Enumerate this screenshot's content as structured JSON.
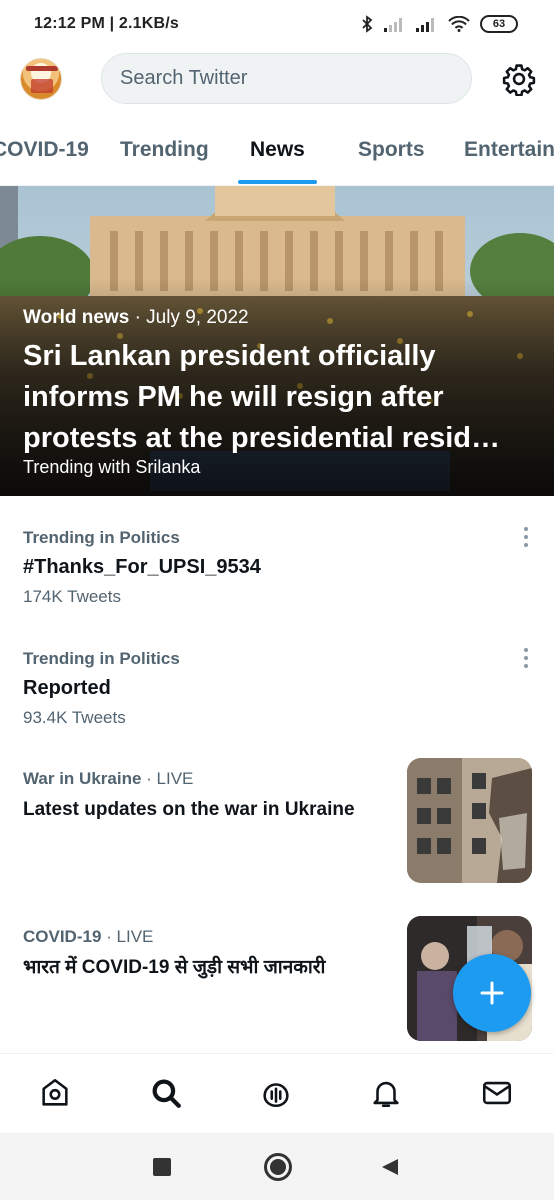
{
  "status_bar": {
    "time_speed": "12:12 PM | 2.1KB/s",
    "battery": "63",
    "icons": [
      "bluetooth-icon",
      "signal-icon",
      "signal-icon",
      "wifi-icon",
      "battery-icon"
    ]
  },
  "header": {
    "avatar": "profile-avatar",
    "search_placeholder": "Search Twitter",
    "settings_icon": "gear-icon"
  },
  "tabs": [
    {
      "label": "COVID-19",
      "active": false
    },
    {
      "label": "Trending",
      "active": false
    },
    {
      "label": "News",
      "active": true
    },
    {
      "label": "Sports",
      "active": false
    },
    {
      "label": "Entertain",
      "active": false
    }
  ],
  "hero": {
    "category": "World news",
    "date": "· July 9, 2022",
    "title": "Sri Lankan president officially informs PM he will resign after protests at the presidential resid…",
    "subtitle": "Trending with Srilanka"
  },
  "trends": [
    {
      "category": "Trending in Politics",
      "name": "#Thanks_For_UPSI_9534",
      "count": "174K Tweets"
    },
    {
      "category": "Trending in Politics",
      "name": "Reported",
      "count": "93.4K Tweets"
    }
  ],
  "news": [
    {
      "category": "War in Ukraine",
      "status": "· LIVE",
      "title": "Latest updates on the war in Ukraine",
      "thumb": "damaged-building-image"
    },
    {
      "category": "COVID-19",
      "status": "· LIVE",
      "title": "भारत में COVID-19 से जुड़ी सभी जानकारी",
      "thumb": "covid-testing-image"
    }
  ],
  "fab": {
    "icon": "plus-icon"
  },
  "bottom_nav": [
    "home-icon",
    "search-icon",
    "spaces-icon",
    "notifications-icon",
    "messages-icon"
  ],
  "system_nav": [
    "recents-icon",
    "home-circle-icon",
    "back-icon"
  ],
  "colors": {
    "accent": "#1d9bf0",
    "text_primary": "#0f1419",
    "text_secondary": "#536471"
  }
}
